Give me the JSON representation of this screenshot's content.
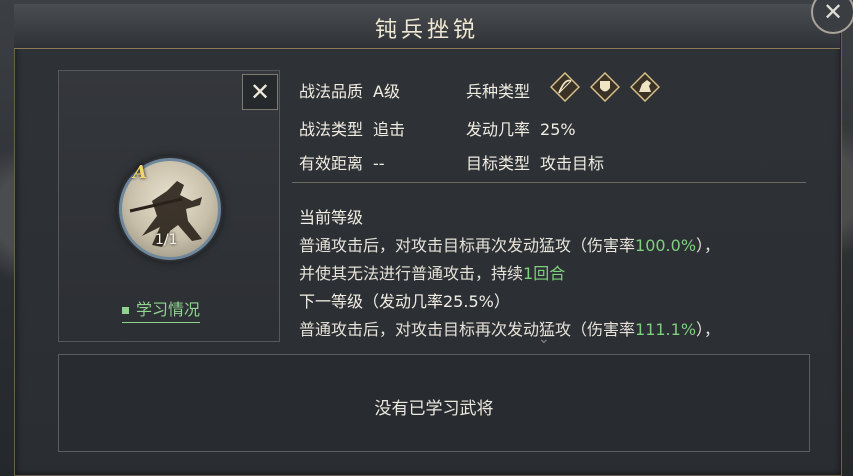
{
  "title": "钝兵挫锐",
  "close_button": "✕",
  "skill": {
    "grade": "A",
    "level": "1/1",
    "learn_status": "学习情况"
  },
  "info": {
    "quality_label": "战法品质",
    "quality_value": "A级",
    "troop_label": "兵种类型",
    "type_label": "战法类型",
    "type_value": "追击",
    "rate_label": "发动几率",
    "rate_value": "25%",
    "range_label": "有效距离",
    "range_value": "--",
    "target_label": "目标类型",
    "target_value": "攻击目标"
  },
  "troop_icons": [
    "bow-troop-icon",
    "shield-troop-icon",
    "cavalry-troop-icon"
  ],
  "description": {
    "current_heading": "当前等级",
    "line1_a": "普通攻击后，对攻击目标再次发动猛攻（伤害率",
    "line1_val": "100.0%",
    "line1_b": "），",
    "line2_a": "并使其无法进行普通攻击，持续",
    "line2_val": "1回合",
    "next_heading": "下一等级（发动几率25.5%）",
    "line3_a": "普通攻击后，对攻击目标再次发动猛攻（伤害率",
    "line3_val": "111.1%",
    "line3_b": "），"
  },
  "empty_message": "没有已学习武将",
  "colors": {
    "accent_green": "#7ecf7e",
    "grade_gold": "#f3d36b",
    "frame_gold": "#8a7a55"
  }
}
